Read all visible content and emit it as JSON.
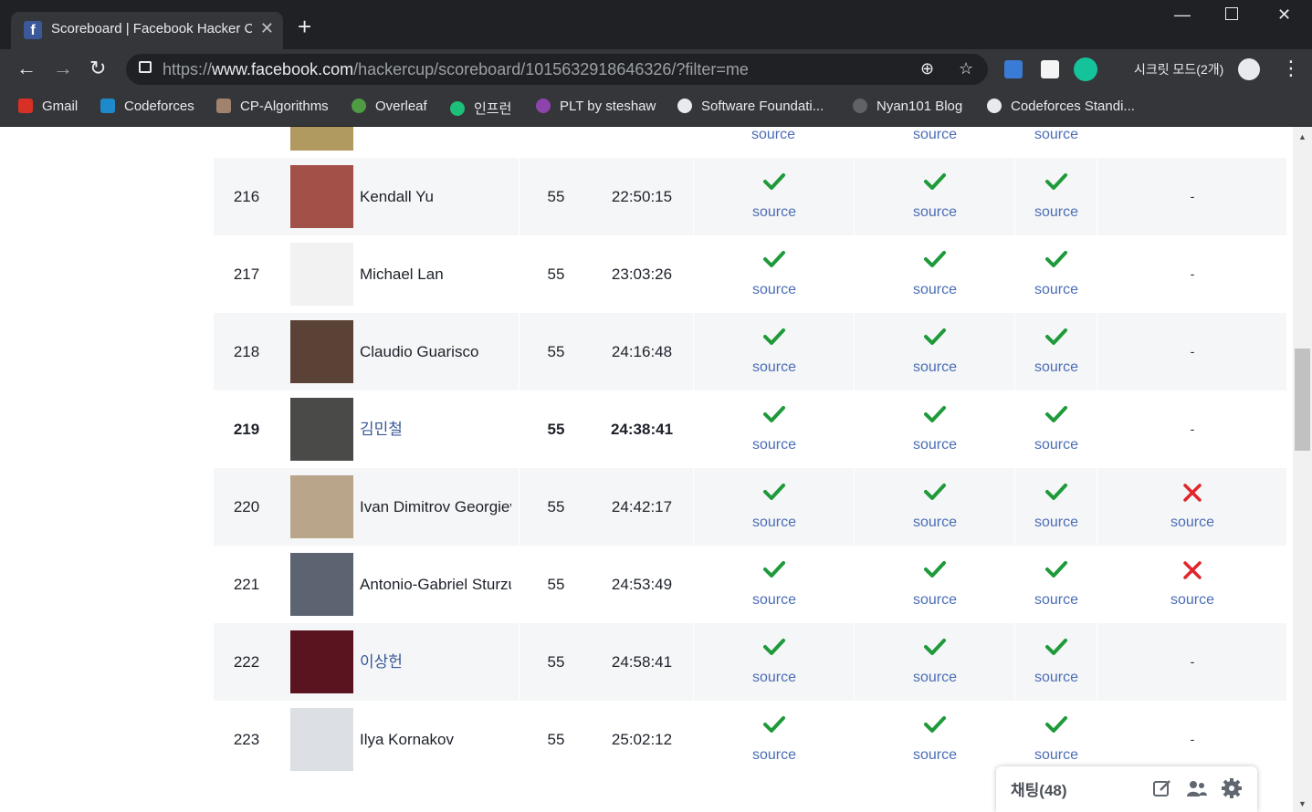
{
  "browser": {
    "tab_title": "Scoreboard | Facebook Hacker Cup",
    "new_tab": "+",
    "url_scheme": "https://",
    "url_host": "www.facebook.com",
    "url_path": "/hackercup/scoreboard/1015632918646326/?filter=me",
    "incognito_label": "시크릿 모드(2개)",
    "bookmarks": [
      {
        "label": "Gmail",
        "color": "#d93025"
      },
      {
        "label": "Codeforces",
        "color": "#1f8acb"
      },
      {
        "label": "CP-Algorithms",
        "color": "#a0826d"
      },
      {
        "label": "Overleaf",
        "color": "#4f9c45"
      },
      {
        "label": "인프런",
        "color": "#1dc078"
      },
      {
        "label": "PLT by steshaw",
        "color": "#8e44ad"
      },
      {
        "label": "Software Foundati...",
        "color": "#e8eaed"
      },
      {
        "label": "Nyan101 Blog",
        "color": "#5f6368"
      },
      {
        "label": "Codeforces Standi...",
        "color": "#e8eaed"
      }
    ]
  },
  "scoreboard": {
    "partial_top": {
      "p1": "source",
      "p2": "source",
      "p3": "source"
    },
    "rows": [
      {
        "rank": "216",
        "name": "Kendall Yu",
        "score": "55",
        "time": "22:50:15",
        "p1": "source",
        "p2": "source",
        "p3": "source",
        "p4": "-",
        "avatar_color": "#a35048"
      },
      {
        "rank": "217",
        "name": "Michael Lan",
        "score": "55",
        "time": "23:03:26",
        "p1": "source",
        "p2": "source",
        "p3": "source",
        "p4": "-",
        "avatar_color": "#f2f2f2"
      },
      {
        "rank": "218",
        "name": "Claudio Guarisco",
        "score": "55",
        "time": "24:16:48",
        "p1": "source",
        "p2": "source",
        "p3": "source",
        "p4": "-",
        "avatar_color": "#5a4236"
      },
      {
        "rank": "219",
        "name": "김민철",
        "score": "55",
        "time": "24:38:41",
        "p1": "source",
        "p2": "source",
        "p3": "source",
        "p4": "-",
        "avatar_color": "#4a4a48"
      },
      {
        "rank": "220",
        "name": "Ivan Dimitrov Georgiev",
        "score": "55",
        "time": "24:42:17",
        "p1": "source",
        "p2": "source",
        "p3": "source",
        "p4": "source",
        "avatar_color": "#b9a58a"
      },
      {
        "rank": "221",
        "name": "Antonio-Gabriel Sturzu",
        "score": "55",
        "time": "24:53:49",
        "p1": "source",
        "p2": "source",
        "p3": "source",
        "p4": "source",
        "avatar_color": "#5b6470"
      },
      {
        "rank": "222",
        "name": "이상헌",
        "score": "55",
        "time": "24:58:41",
        "p1": "source",
        "p2": "source",
        "p3": "source",
        "p4": "-",
        "avatar_color": "#5a1420"
      },
      {
        "rank": "223",
        "name": "Ilya Kornakov",
        "score": "55",
        "time": "25:02:12",
        "p1": "source",
        "p2": "source",
        "p3": "source",
        "p4": "-",
        "avatar_color": "#dcdfe3"
      }
    ]
  },
  "chat": {
    "label": "채팅(48)"
  },
  "colors": {
    "check": "#1e9a3a",
    "cross": "#e0262b",
    "link": "#4b6db6"
  }
}
